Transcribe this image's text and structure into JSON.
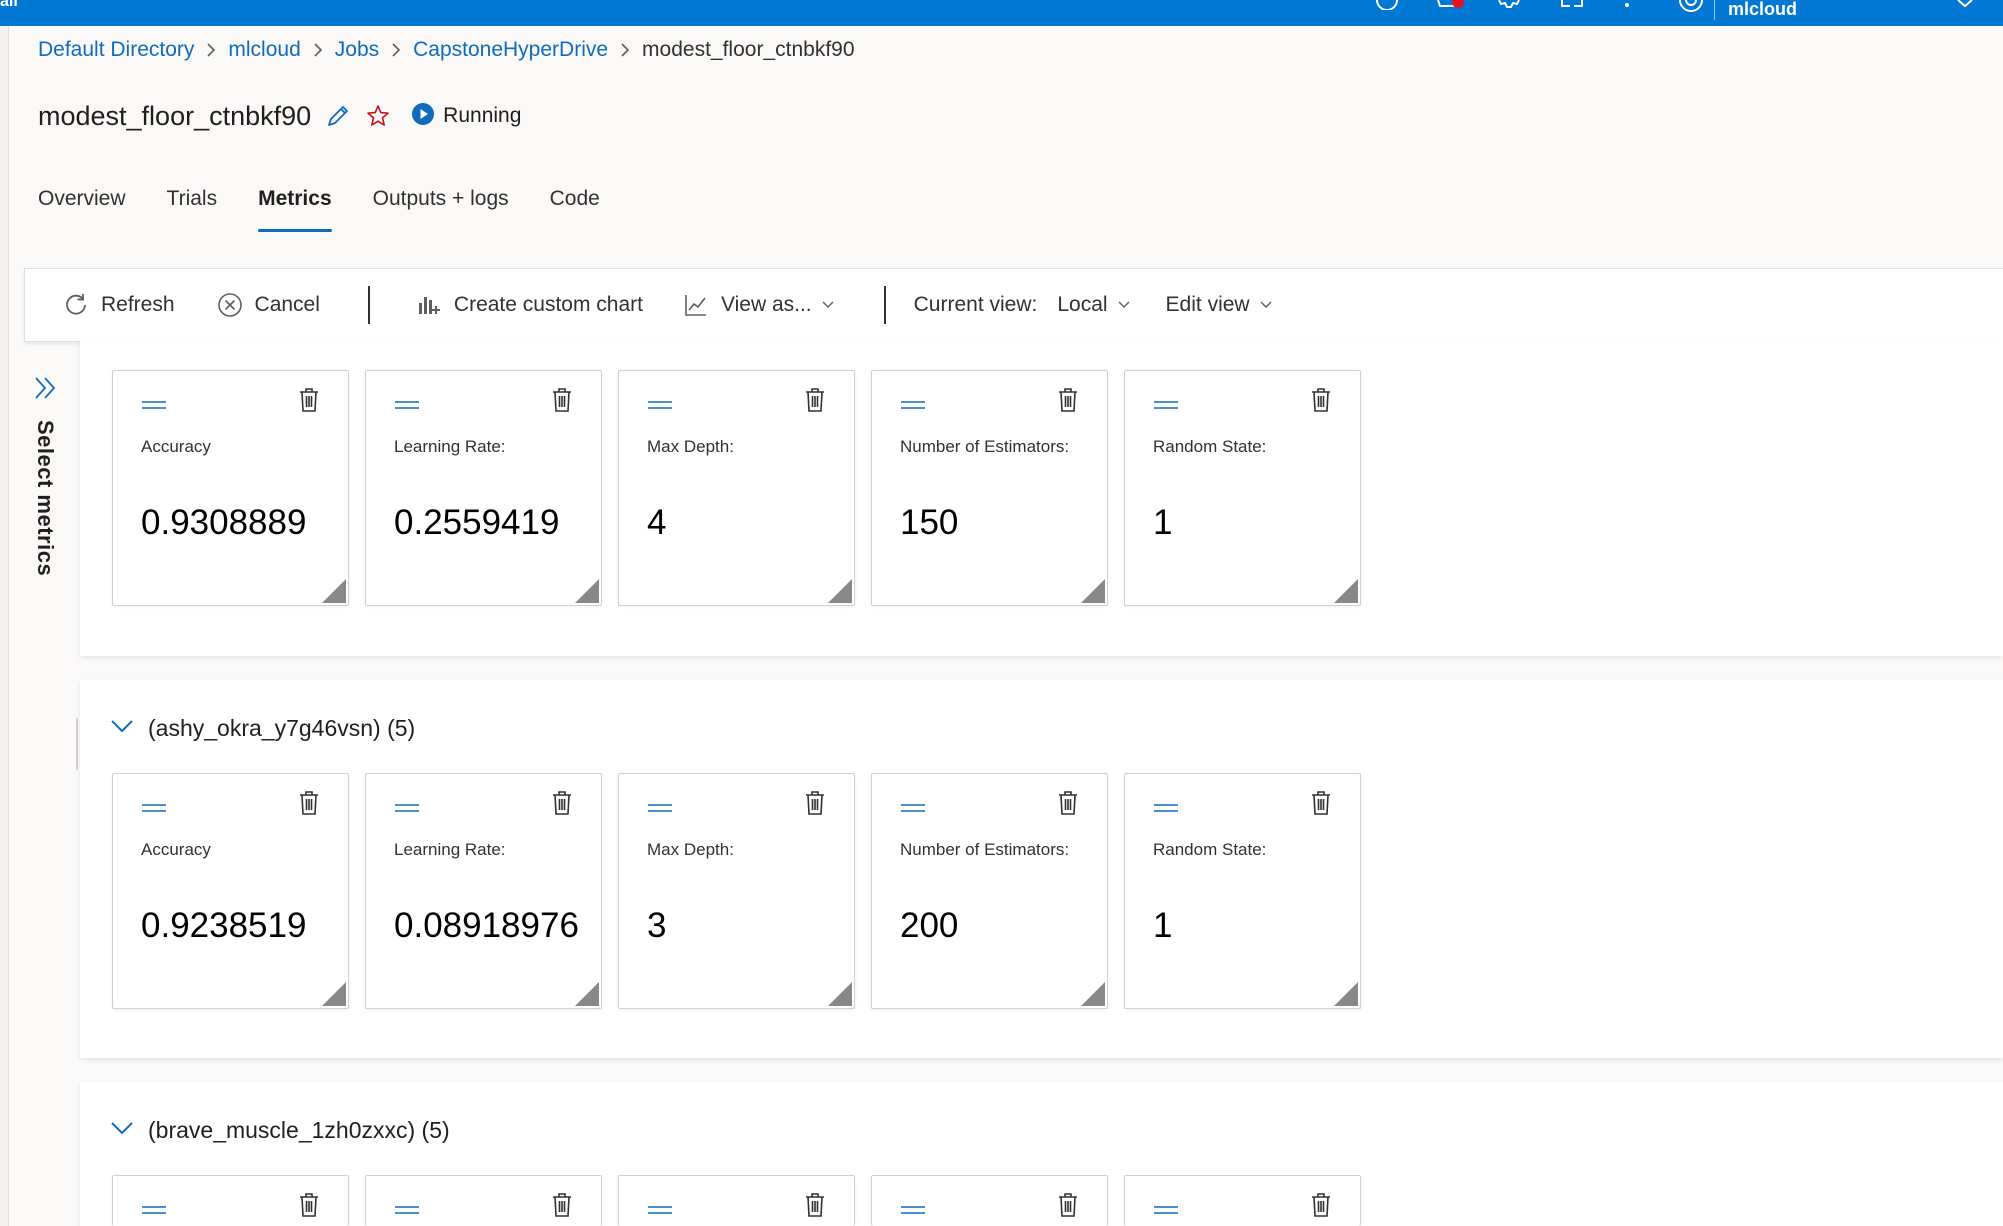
{
  "app": {
    "brand_fragment": "ail",
    "workspace": "mlcloud",
    "accent": "#0078d4",
    "topbar_icons": [
      "help-circle-icon",
      "notifications-bell-icon",
      "settings-gear-icon",
      "feedback-icon",
      "help-question-icon",
      "account-icon",
      "chevron-down-icon"
    ]
  },
  "breadcrumb": {
    "items": [
      "Default Directory",
      "mlcloud",
      "Jobs",
      "CapstoneHyperDrive"
    ],
    "current": "modest_floor_ctnbkf90"
  },
  "job": {
    "title": "modest_floor_ctnbkf90",
    "status": "Running"
  },
  "tabs": [
    "Overview",
    "Trials",
    "Metrics",
    "Outputs + logs",
    "Code"
  ],
  "active_tab": "Metrics",
  "toolbar": {
    "refresh": "Refresh",
    "cancel": "Cancel",
    "create_chart": "Create custom chart",
    "view_as": "View as...",
    "current_view_label": "Current view:",
    "current_view_value": "Local",
    "edit_view": "Edit view"
  },
  "sidebar": {
    "select_metrics": "Select metrics"
  },
  "groups": [
    {
      "title": "",
      "cards": [
        {
          "label": "Accuracy",
          "value": "0.9308889"
        },
        {
          "label": "Learning Rate:",
          "value": "0.2559419"
        },
        {
          "label": "Max Depth:",
          "value": "4"
        },
        {
          "label": "Number of Estimators:",
          "value": "150"
        },
        {
          "label": "Random State:",
          "value": "1"
        }
      ]
    },
    {
      "title": "(ashy_okra_y7g46vsn) (5)",
      "cards": [
        {
          "label": "Accuracy",
          "value": "0.9238519"
        },
        {
          "label": "Learning Rate:",
          "value": "0.08918976"
        },
        {
          "label": "Max Depth:",
          "value": "3"
        },
        {
          "label": "Number of Estimators:",
          "value": "200"
        },
        {
          "label": "Random State:",
          "value": "1"
        }
      ]
    },
    {
      "title": "(brave_muscle_1zh0zxxc) (5)",
      "cards": [
        {
          "label": "",
          "value": ""
        },
        {
          "label": "",
          "value": ""
        },
        {
          "label": "",
          "value": ""
        },
        {
          "label": "",
          "value": ""
        },
        {
          "label": "",
          "value": ""
        }
      ]
    }
  ]
}
